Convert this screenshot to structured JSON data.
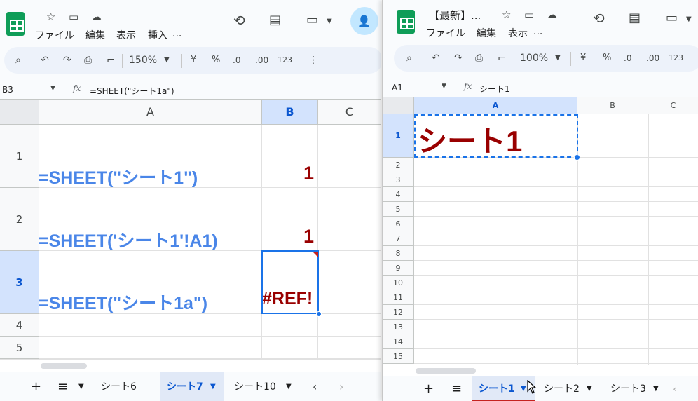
{
  "left": {
    "menu": [
      "ファイル",
      "編集",
      "表示",
      "挿入",
      "..."
    ],
    "zoom": "150%",
    "toolbar": {
      "currency": "¥",
      "percent": "%",
      "dec_minus": ".0",
      "dec_plus": ".00",
      "format_123": "123"
    },
    "name_box": "B3",
    "formula": "=SHEET(\"シート1a\")",
    "fx": "fx",
    "columns": [
      "A",
      "B",
      "C"
    ],
    "rows": [
      "1",
      "2",
      "3",
      "4",
      "5"
    ],
    "cells": [
      {
        "a": "=SHEET(\"シート1\")",
        "b": "1"
      },
      {
        "a": "=SHEET('シート1'!A1)",
        "b": "1"
      },
      {
        "a": "=SHEET(\"シート1a\")",
        "b": "#REF!"
      }
    ],
    "tabs": [
      "シート6",
      "シート7",
      "シート10"
    ],
    "active_tab": "シート7",
    "add_sheet": "+",
    "all_sheets": "≡"
  },
  "right": {
    "title": "【最新】...",
    "menu": [
      "ファイル",
      "編集",
      "表示",
      "..."
    ],
    "zoom": "100%",
    "toolbar": {
      "currency": "¥",
      "percent": "%",
      "dec_minus": ".0",
      "dec_plus": ".00",
      "format_123": "123"
    },
    "name_box": "A1",
    "formula": "シート1",
    "fx": "fx",
    "columns": [
      "A",
      "B",
      "C"
    ],
    "rows": [
      "1",
      "2",
      "3",
      "4",
      "5",
      "6",
      "7",
      "8",
      "9",
      "10",
      "11",
      "12",
      "13",
      "14",
      "15"
    ],
    "a1": "シート1",
    "tabs": [
      "シート1",
      "シート2",
      "シート3"
    ],
    "active_tab": "シート1",
    "add_sheet": "+",
    "all_sheets": "≡"
  },
  "colors": {
    "formula_text": "#4a86e8",
    "value_text": "#990000",
    "selection": "#1a73e8",
    "sheets_green": "#0f9d58"
  },
  "icons": [
    "star-icon",
    "move-to-folder-icon",
    "cloud-saved-icon",
    "history-icon",
    "comment-icon",
    "video-call-icon",
    "share-icon",
    "search-icon",
    "undo-icon",
    "redo-icon",
    "print-icon",
    "paint-format-icon",
    "more-vert-icon",
    "chevron-down-icon",
    "chevron-left-icon",
    "chevron-right-icon",
    "mouse-cursor-icon"
  ]
}
